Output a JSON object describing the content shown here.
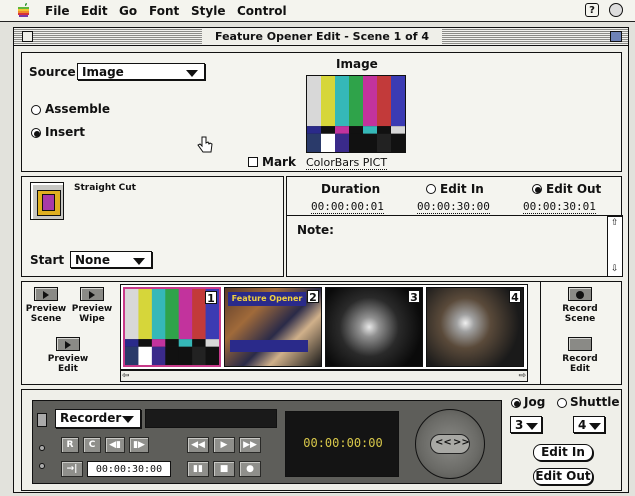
{
  "menubar": {
    "items": [
      "File",
      "Edit",
      "Go",
      "Font",
      "Style",
      "Control"
    ],
    "apple_icon": "apple-logo",
    "right_icons": [
      "help-balloon-icon",
      "application-icon"
    ]
  },
  "window": {
    "title": "Feature Opener Edit - Scene 1 of 4"
  },
  "source": {
    "label": "Source",
    "value": "Image",
    "options_mode": [
      "Assemble",
      "Insert"
    ],
    "selected_mode": "Insert"
  },
  "image_preview": {
    "heading": "Image",
    "filename": "ColorBars PICT",
    "mark_label": "Mark",
    "colorbars": [
      "#d8d8d8",
      "#d6d63a",
      "#35b8b8",
      "#2fa34a",
      "#c2339d",
      "#c23a3a",
      "#3b3bb3"
    ]
  },
  "transition": {
    "name": "Straight Cut",
    "start_label": "Start",
    "start_value": "None"
  },
  "timing": {
    "duration_label": "Duration",
    "duration_value": "00:00:00:01",
    "edit_in_label": "Edit In",
    "edit_in_value": "00:00:30:00",
    "edit_out_label": "Edit Out",
    "edit_out_value": "00:00:30:01",
    "selected": "Edit Out",
    "note_label": "Note:"
  },
  "storyboard": {
    "left_buttons": [
      "Preview Scene",
      "Preview Wipe",
      "Preview Edit"
    ],
    "right_buttons": [
      "Record Scene",
      "Record Edit"
    ],
    "scenes": [
      {
        "number": "1",
        "kind": "colorbars"
      },
      {
        "number": "2",
        "kind": "video",
        "caption": "Feature Opener"
      },
      {
        "number": "3",
        "kind": "video"
      },
      {
        "number": "4",
        "kind": "video"
      }
    ]
  },
  "deck": {
    "device": "Recorder",
    "transport_labels": [
      "R",
      "C",
      "◀▮",
      "▮▶",
      "◀◀",
      "▶",
      "▶▶",
      "▮▮",
      "■",
      "●"
    ],
    "timecode_field": "00:00:30:00",
    "display_timecode": "00:00:00:00",
    "jog_label": "Jog",
    "shuttle_label": "Shuttle",
    "jog_selected": true,
    "jog_value": "3",
    "shuttle_value": "4",
    "edit_in_button": "Edit In",
    "edit_out_button": "Edit Out",
    "wheel_buttons": [
      "<<",
      ">>"
    ]
  }
}
